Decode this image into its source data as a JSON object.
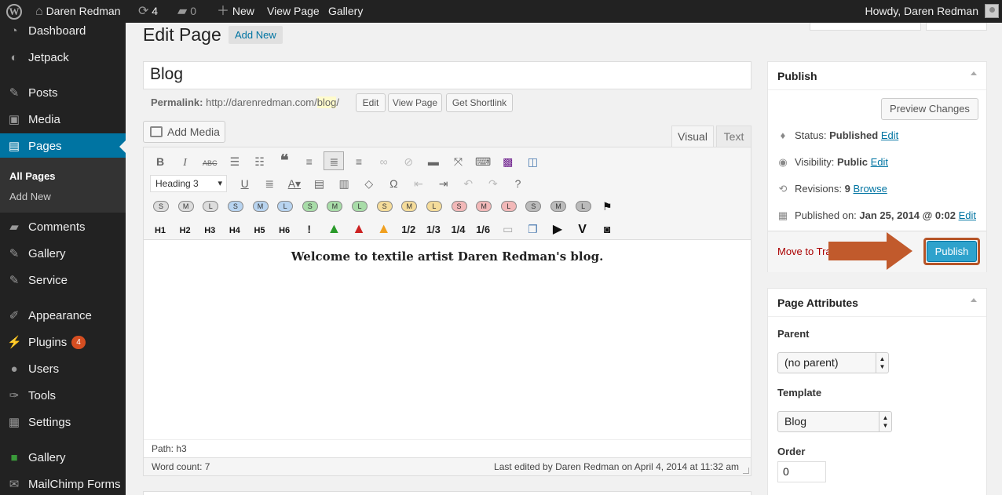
{
  "admin_bar": {
    "site_name": "Daren Redman",
    "updates_count": "4",
    "comments_count": "0",
    "new_label": "New",
    "view_page_label": "View Page",
    "gallery_label": "Gallery",
    "howdy": "Howdy, Daren Redman"
  },
  "sidebar": {
    "items": [
      {
        "label": "Dashboard",
        "icon": "dashboard-icon"
      },
      {
        "label": "Jetpack",
        "icon": "jetpack-icon"
      },
      {
        "label": "Posts",
        "icon": "pin-icon"
      },
      {
        "label": "Media",
        "icon": "media-icon"
      },
      {
        "label": "Pages",
        "icon": "pages-icon"
      },
      {
        "label": "Comments",
        "icon": "comment-icon"
      },
      {
        "label": "Gallery",
        "icon": "pin-icon"
      },
      {
        "label": "Service",
        "icon": "pin-icon"
      },
      {
        "label": "Appearance",
        "icon": "brush-icon"
      },
      {
        "label": "Plugins",
        "icon": "plug-icon",
        "badge": "4"
      },
      {
        "label": "Users",
        "icon": "user-icon"
      },
      {
        "label": "Tools",
        "icon": "wrench-icon"
      },
      {
        "label": "Settings",
        "icon": "settings-icon"
      },
      {
        "label": "Gallery",
        "icon": "gallery-square-icon"
      },
      {
        "label": "MailChimp Forms",
        "icon": "mail-icon"
      }
    ],
    "submenu": [
      "All Pages",
      "Add New"
    ],
    "accent": "#0074a2"
  },
  "header": {
    "title": "Edit Page",
    "add_new": "Add New"
  },
  "editor": {
    "title_value": "Blog",
    "permalink_label": "Permalink:",
    "permalink_base": "http://darenredman.com/",
    "permalink_slug": "blog",
    "permalink_tail": "/",
    "edit_btn": "Edit",
    "view_page_btn": "View Page",
    "shortlink_btn": "Get Shortlink",
    "add_media": "Add Media",
    "tab_visual": "Visual",
    "tab_text": "Text",
    "format_select": "Heading 3",
    "headings": [
      "H1",
      "H2",
      "H3",
      "H4",
      "H5",
      "H6"
    ],
    "fractions": [
      "1/2",
      "1/3",
      "1/4",
      "1/6"
    ],
    "content_heading": "Welcome to textile artist Daren Redman's blog.",
    "path": "Path: h3",
    "word_count": "Word count: 7",
    "last_edited": "Last edited by Daren Redman on April 4, 2014 at 11:32 am"
  },
  "publish_box": {
    "title": "Publish",
    "preview_btn": "Preview Changes",
    "status_label": "Status:",
    "status_value": "Published",
    "visibility_label": "Visibility:",
    "visibility_value": "Public",
    "revisions_label": "Revisions:",
    "revisions_value": "9",
    "browse_link": "Browse",
    "published_on_label": "Published on:",
    "published_on_value": "Jan 25, 2014 @ 0:02",
    "edit_link": "Edit",
    "trash_link": "Move to Trash",
    "publish_btn": "Publish",
    "annotation_color": "#c15a2c",
    "button_color": "#2ea2cc"
  },
  "page_attributes": {
    "title": "Page Attributes",
    "parent_label": "Parent",
    "parent_value": "(no parent)",
    "template_label": "Template",
    "template_value": "Blog",
    "order_label": "Order",
    "order_value": "0"
  }
}
